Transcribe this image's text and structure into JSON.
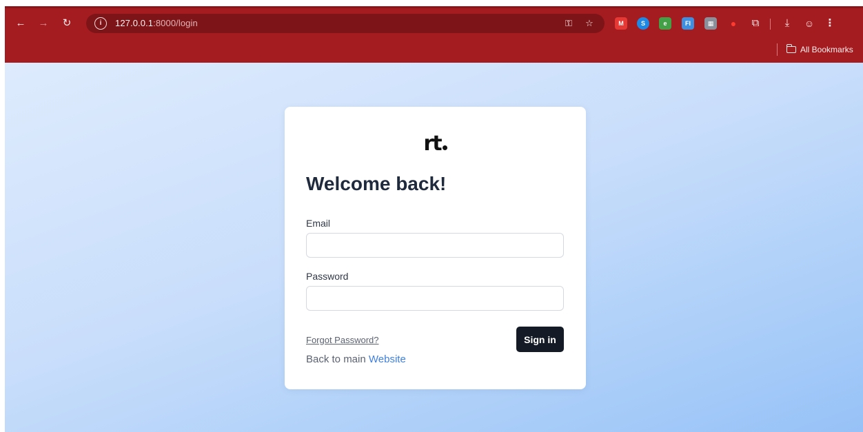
{
  "browser": {
    "url_host": "127.0.0.1",
    "url_rest": ":8000/login",
    "bookmarks_label": "All Bookmarks",
    "colors": {
      "toolbar": "#a51c20",
      "omnibox": "#7d1418"
    },
    "extensions": [
      {
        "name": "extension-red-icon",
        "text": "M",
        "color": "#e53935"
      },
      {
        "name": "extension-blue-icon",
        "text": "S",
        "color": "#1e88e5"
      },
      {
        "name": "extension-green-icon",
        "text": "e",
        "color": "#43a047"
      },
      {
        "name": "extension-fi-icon",
        "text": "FI",
        "color": "#3f8fe0"
      },
      {
        "name": "extension-grid-icon",
        "text": "▦",
        "color": "#8a8f99"
      },
      {
        "name": "extension-red-drop-icon",
        "text": "●",
        "color": "#d81b1b"
      }
    ]
  },
  "login": {
    "logo": "rt",
    "title": "Welcome back!",
    "email_label": "Email",
    "email_value": "",
    "password_label": "Password",
    "password_value": "",
    "forgot_link": "Forgot Password?",
    "back_text": "Back to main",
    "back_link": "Website",
    "submit": "Sign in",
    "colors": {
      "button": "#141b27",
      "link": "#3f7fe0",
      "heading": "#1f2a3c"
    }
  }
}
